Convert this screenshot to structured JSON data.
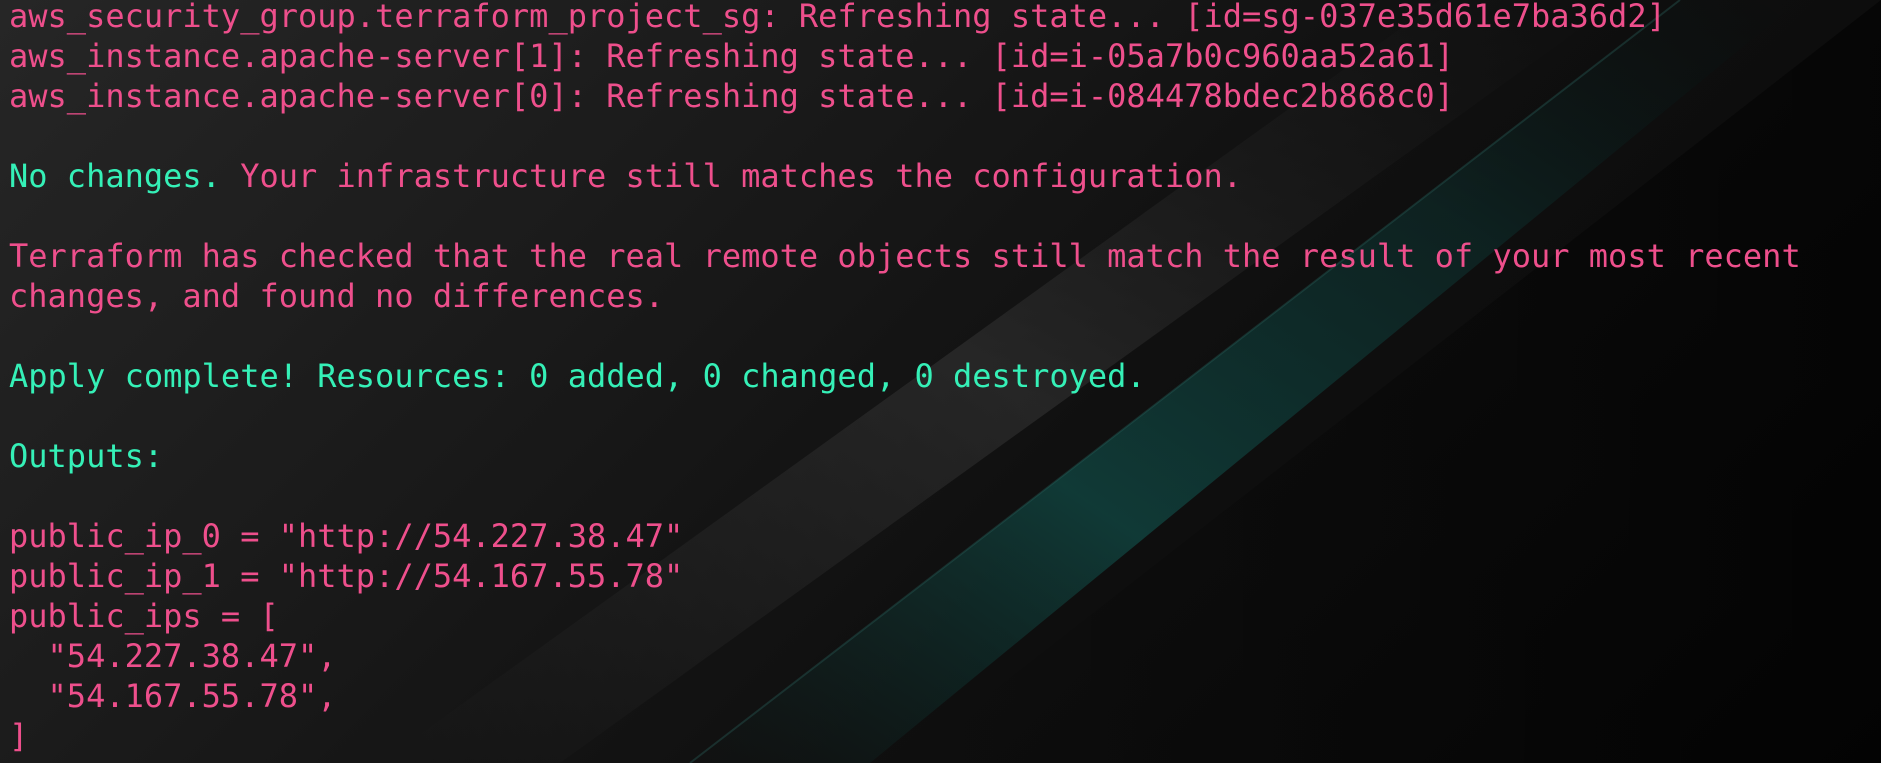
{
  "colors": {
    "text_pink": "#ee4f8c",
    "text_green": "#35f0b7",
    "background": "#0a0a0a"
  },
  "terminal": {
    "lines": [
      {
        "segments": [
          {
            "text": "aws_security_group.terraform_project_sg: Refreshing state... [id=sg-037e35d61e7ba36d2]",
            "color": "pink"
          }
        ]
      },
      {
        "segments": [
          {
            "text": "aws_instance.apache-server[1]: Refreshing state... [id=i-05a7b0c960aa52a61]",
            "color": "pink"
          }
        ]
      },
      {
        "segments": [
          {
            "text": "aws_instance.apache-server[0]: Refreshing state... [id=i-084478bdec2b868c0]",
            "color": "pink"
          }
        ]
      },
      {
        "segments": [
          {
            "text": "",
            "color": "pink"
          }
        ]
      },
      {
        "segments": [
          {
            "text": "No changes.",
            "color": "green"
          },
          {
            "text": " Your infrastructure still matches the configuration.",
            "color": "pink"
          }
        ]
      },
      {
        "segments": [
          {
            "text": "",
            "color": "pink"
          }
        ]
      },
      {
        "segments": [
          {
            "text": "Terraform has checked that the real remote objects still match the result of your most recent",
            "color": "pink"
          }
        ]
      },
      {
        "segments": [
          {
            "text": "changes, and found no differences.",
            "color": "pink"
          }
        ]
      },
      {
        "segments": [
          {
            "text": "",
            "color": "pink"
          }
        ]
      },
      {
        "segments": [
          {
            "text": "Apply complete! Resources: 0 added, 0 changed, 0 destroyed.",
            "color": "green"
          }
        ]
      },
      {
        "segments": [
          {
            "text": "",
            "color": "pink"
          }
        ]
      },
      {
        "segments": [
          {
            "text": "Outputs:",
            "color": "green"
          }
        ]
      },
      {
        "segments": [
          {
            "text": "",
            "color": "pink"
          }
        ]
      },
      {
        "segments": [
          {
            "text": "public_ip_0 = \"http://54.227.38.47\"",
            "color": "pink"
          }
        ]
      },
      {
        "segments": [
          {
            "text": "public_ip_1 = \"http://54.167.55.78\"",
            "color": "pink"
          }
        ]
      },
      {
        "segments": [
          {
            "text": "public_ips = [",
            "color": "pink"
          }
        ]
      },
      {
        "segments": [
          {
            "text": "  \"54.227.38.47\",",
            "color": "pink"
          }
        ]
      },
      {
        "segments": [
          {
            "text": "  \"54.167.55.78\",",
            "color": "pink"
          }
        ]
      },
      {
        "segments": [
          {
            "text": "]",
            "color": "pink"
          }
        ]
      }
    ]
  }
}
